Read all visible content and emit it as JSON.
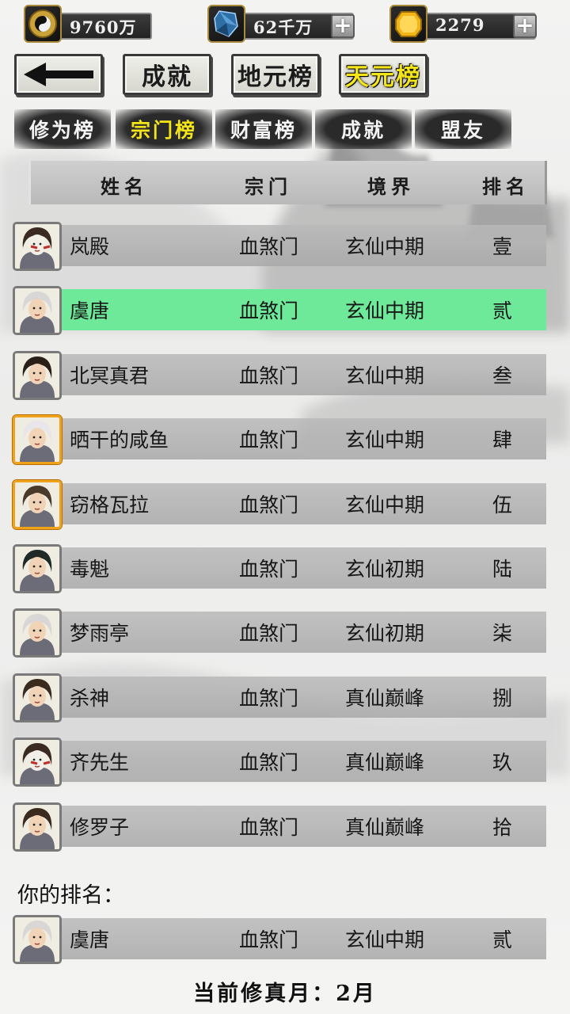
{
  "resources": [
    {
      "icon": "taiji-coin-icon",
      "value": "9760万",
      "has_plus": false
    },
    {
      "icon": "spirit-crystal-icon",
      "value": "62千万",
      "has_plus": true
    },
    {
      "icon": "gold-ingot-icon",
      "value": "2279",
      "has_plus": true
    }
  ],
  "nav": {
    "back_icon": "back-arrow-icon",
    "buttons": [
      "成就",
      "地元榜",
      "天元榜"
    ],
    "active_index": 2
  },
  "subtabs": {
    "items": [
      "修为榜",
      "宗门榜",
      "财富榜",
      "成就",
      "盟友"
    ],
    "active_index": 1
  },
  "table": {
    "headers": {
      "name": "姓名",
      "sect": "宗门",
      "realm": "境界",
      "rank": "排名"
    },
    "rows": [
      {
        "name": "岚殿",
        "sect": "血煞门",
        "realm": "玄仙中期",
        "rank": "壹",
        "avatar": "masked-warrior-avatar",
        "frame": "silver"
      },
      {
        "name": "虞唐",
        "sect": "血煞门",
        "realm": "玄仙中期",
        "rank": "贰",
        "avatar": "fox-spirit-avatar",
        "frame": "silver",
        "highlight": true
      },
      {
        "name": "北冥真君",
        "sect": "血煞门",
        "realm": "玄仙中期",
        "rank": "叁",
        "avatar": "scholar-avatar",
        "frame": "silver"
      },
      {
        "name": "晒干的咸鱼",
        "sect": "血煞门",
        "realm": "玄仙中期",
        "rank": "肆",
        "avatar": "white-haired-avatar",
        "frame": "gold"
      },
      {
        "name": "窃格瓦拉",
        "sect": "血煞门",
        "realm": "玄仙中期",
        "rank": "伍",
        "avatar": "sage-avatar",
        "frame": "gold"
      },
      {
        "name": "毒魁",
        "sect": "血煞门",
        "realm": "玄仙初期",
        "rank": "陆",
        "avatar": "lady-avatar",
        "frame": "silver"
      },
      {
        "name": "梦雨亭",
        "sect": "血煞门",
        "realm": "玄仙初期",
        "rank": "柒",
        "avatar": "fox-spirit-avatar",
        "frame": "silver"
      },
      {
        "name": "杀神",
        "sect": "血煞门",
        "realm": "真仙巅峰",
        "rank": "捌",
        "avatar": "swordsman-avatar",
        "frame": "silver"
      },
      {
        "name": "齐先生",
        "sect": "血煞门",
        "realm": "真仙巅峰",
        "rank": "玖",
        "avatar": "masked-warrior-avatar",
        "frame": "silver"
      },
      {
        "name": "修罗子",
        "sect": "血煞门",
        "realm": "真仙巅峰",
        "rank": "拾",
        "avatar": "swordsman-avatar",
        "frame": "silver"
      }
    ]
  },
  "your_rank": {
    "label": "你的排名：",
    "row": {
      "name": "虞唐",
      "sect": "血煞门",
      "realm": "玄仙中期",
      "rank": "贰",
      "avatar": "fox-spirit-avatar",
      "frame": "silver"
    }
  },
  "footer": "当前修真月：2月",
  "colors": {
    "highlight_row": "#6ee99a",
    "active_tab_text": "#f4e51a",
    "gold_frame": "#f0a21a"
  }
}
